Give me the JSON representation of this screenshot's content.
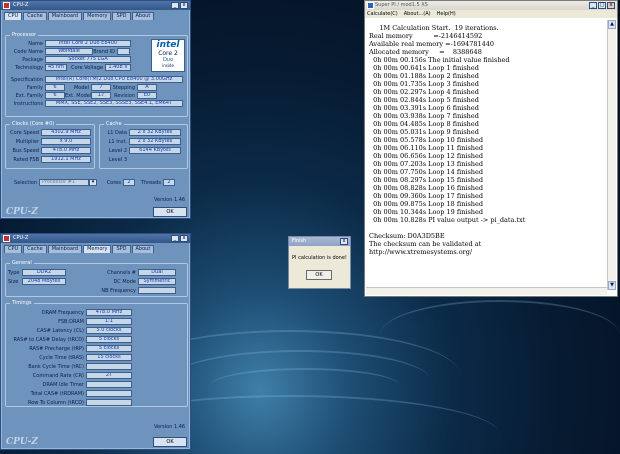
{
  "cpuz1": {
    "title": "CPU-Z",
    "tabs": [
      "CPU",
      "Cache",
      "Mainboard",
      "Memory",
      "SPD",
      "About"
    ],
    "processor": {
      "label": "Processor",
      "name_l": "Name",
      "name": "Intel Core 2 Duo E8400",
      "code_l": "Code Name",
      "code": "Wolfdale",
      "brand_l": "Brand ID",
      "pkg_l": "Package",
      "pkg": "Socket 775 LGA",
      "tech_l": "Technology",
      "tech": "45 nm",
      "volt_l": "Core Voltage",
      "volt": "1.408 V",
      "spec_l": "Specification",
      "spec": "Intel(R) Core(TM)2 Duo CPU     E8400  @ 3.00GHz",
      "fam_l": "Family",
      "fam": "6",
      "model_l": "Model",
      "model": "7",
      "step_l": "Stepping",
      "step": "A",
      "efam_l": "Ext. Family",
      "efam": "6",
      "emod_l": "Ext. Model",
      "emod": "17",
      "rev_l": "Revision",
      "rev": "E0",
      "inst_l": "Instructions",
      "inst": "MMX, SSE, SSE2, SSE3, SSSE3, SSE4.1, EM64T"
    },
    "intel": {
      "brand": "intel",
      "line": "Core 2",
      "sub": "Duo",
      "tag": "inside"
    },
    "clocks": {
      "label": "Clocks (Core #0)",
      "speed_l": "Core Speed",
      "speed": "4302.9 MHz",
      "mult_l": "Multiplier",
      "mult": "x 9.0",
      "bus_l": "Bus Speed",
      "bus": "478.0 MHz",
      "fsb_l": "Rated FSB",
      "fsb": "1912.1 MHz"
    },
    "cache": {
      "label": "Cache",
      "l1d_l": "L1 Data",
      "l1d": "2 x 32 KBytes",
      "l1i_l": "L1 Inst.",
      "l1i": "2 x 32 KBytes",
      "l2_l": "Level 2",
      "l2": "6144 KBytes",
      "l3_l": "Level 3",
      "l3": ""
    },
    "sel_l": "Selection",
    "sel": "Processor #1",
    "cores_l": "Cores",
    "cores": "2",
    "threads_l": "Threads",
    "threads": "2",
    "version": "Version 1.46",
    "logo": "CPU-Z",
    "ok": "OK"
  },
  "cpuz2": {
    "title": "CPU-Z",
    "tabs": [
      "CPU",
      "Cache",
      "Mainboard",
      "Memory",
      "SPD",
      "About"
    ],
    "general": {
      "label": "General",
      "type_l": "Type",
      "type": "DDR2",
      "ch_l": "Channels #",
      "ch": "Dual",
      "size_l": "Size",
      "size": "2048 MBytes",
      "dc_l": "DC Mode",
      "dc": "Symmetric",
      "nb_l": "NB Frequency",
      "nb": ""
    },
    "timings": {
      "label": "Timings",
      "rows": [
        {
          "l": "DRAM Frequency",
          "v": "478.0 MHz"
        },
        {
          "l": "FSB:DRAM",
          "v": "1:1"
        },
        {
          "l": "CAS# Latency (CL)",
          "v": "5.0 clocks"
        },
        {
          "l": "RAS# to CAS# Delay (tRCD)",
          "v": "5 clocks"
        },
        {
          "l": "RAS# Precharge (tRP)",
          "v": "5 clocks"
        },
        {
          "l": "Cycle Time (tRAS)",
          "v": "15 clocks"
        },
        {
          "l": "Bank Cycle Time (tRC)",
          "v": ""
        },
        {
          "l": "Command Rate (CR)",
          "v": "2T"
        },
        {
          "l": "DRAM Idle Timer",
          "v": ""
        },
        {
          "l": "Total CAS# (tRDRAM)",
          "v": ""
        },
        {
          "l": "Row To Column (tRCD)",
          "v": ""
        }
      ]
    },
    "version": "Version 1.46",
    "logo": "CPU-Z",
    "ok": "OK"
  },
  "finish": {
    "title": "Finish",
    "msg": "PI calculation is done!",
    "ok": "OK"
  },
  "superpi": {
    "title": "Super PI / mod1.5 XS",
    "menu": [
      "Calculate(C)",
      "About...(A)",
      "Help(H)"
    ],
    "lines": [
      "     1M Calculation Start.  19 iterations.",
      "Real memory          =-2146414592",
      "Available real memory =-1694781440",
      "Allocated memory     =    8388648",
      "  0h 00m 00.156s The initial value finished",
      "  0h 00m 00.641s Loop 1 finished",
      "  0h 00m 01.188s Loop 2 finished",
      "  0h 00m 01.735s Loop 3 finished",
      "  0h 00m 02.297s Loop 4 finished",
      "  0h 00m 02.844s Loop 5 finished",
      "  0h 00m 03.391s Loop 6 finished",
      "  0h 00m 03.938s Loop 7 finished",
      "  0h 00m 04.485s Loop 8 finished",
      "  0h 00m 05.031s Loop 9 finished",
      "  0h 00m 05.578s Loop 10 finished",
      "  0h 00m 06.110s Loop 11 finished",
      "  0h 00m 06.656s Loop 12 finished",
      "  0h 00m 07.203s Loop 13 finished",
      "  0h 00m 07.750s Loop 14 finished",
      "  0h 00m 08.297s Loop 15 finished",
      "  0h 00m 08.828s Loop 16 finished",
      "  0h 00m 09.360s Loop 17 finished",
      "  0h 00m 09.875s Loop 18 finished",
      "  0h 00m 10.344s Loop 19 finished",
      "  0h 00m 10.828s PI value output -> pi_data.txt",
      "",
      "Checksum: D0A3D5BE",
      "The checksum can be validated at",
      "http://www.xtremesystems.org/"
    ]
  },
  "colors": {
    "desktop": "#0b2a47",
    "cpuz_panel": "#6e93bd",
    "field": "#c7d7ea",
    "field_text": "#1838a8"
  }
}
